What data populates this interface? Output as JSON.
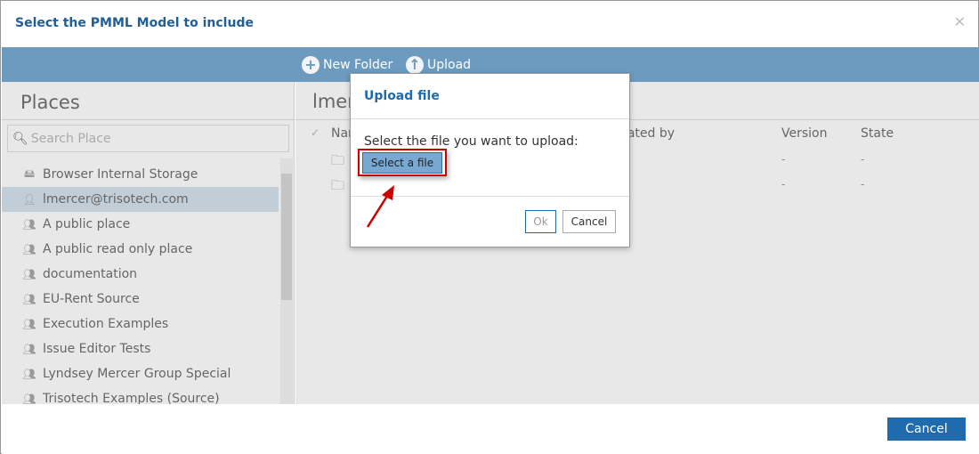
{
  "dialog": {
    "title": "Select the PMML Model to include",
    "close_icon": "close-icon",
    "cancel_label": "Cancel"
  },
  "toolbar": {
    "new_folder": "New Folder",
    "upload": "Upload"
  },
  "places": {
    "title": "Places",
    "search_placeholder": "Search Place",
    "items": [
      {
        "label": "Browser Internal Storage",
        "icon": "drive-icon"
      },
      {
        "label": "lmercer@trisotech.com",
        "icon": "user-icon",
        "selected": true
      },
      {
        "label": "A public place",
        "icon": "group-icon"
      },
      {
        "label": "A public read only place",
        "icon": "group-icon"
      },
      {
        "label": "documentation",
        "icon": "group-icon"
      },
      {
        "label": "EU-Rent Source",
        "icon": "group-icon"
      },
      {
        "label": "Execution Examples",
        "icon": "group-icon"
      },
      {
        "label": "Issue Editor Tests",
        "icon": "group-icon"
      },
      {
        "label": "Lyndsey Mercer Group Special",
        "icon": "group-icon"
      },
      {
        "label": "Trisotech Examples (Source)",
        "icon": "group-icon"
      }
    ]
  },
  "main": {
    "header": "lmercer@trisotech.com",
    "columns": {
      "name": "Name",
      "created_by": "Created by",
      "version": "Version",
      "state": "State"
    },
    "rows": [
      {
        "version": "-",
        "state": "-"
      },
      {
        "version": "-",
        "state": "-"
      }
    ]
  },
  "upload_modal": {
    "title": "Upload file",
    "message": "Select the file you want to upload:",
    "select_label": "Select a file",
    "ok_label": "Ok",
    "cancel_label": "Cancel",
    "highlight_color": "#cc0000"
  }
}
